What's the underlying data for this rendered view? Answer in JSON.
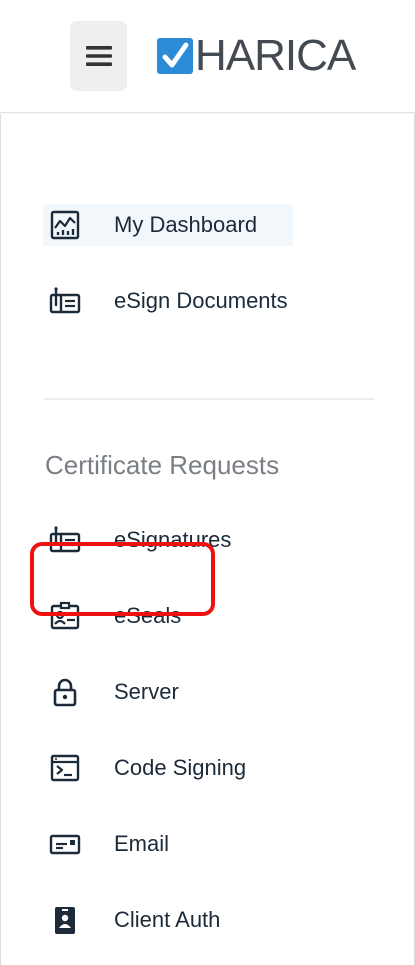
{
  "header": {
    "logo_text": "HARICA",
    "menu_icon": "hamburger-menu-icon",
    "brand_color": "#2b8bd6"
  },
  "sidebar": {
    "main_items": [
      {
        "label": "My Dashboard",
        "icon": "dashboard-chart-icon",
        "active": true
      },
      {
        "label": "eSign Documents",
        "icon": "esign-document-icon",
        "active": false
      }
    ],
    "section_title": "Certificate Requests",
    "request_items": [
      {
        "label": "eSignatures",
        "icon": "esignature-icon"
      },
      {
        "label": "eSeals",
        "icon": "eseal-badge-icon"
      },
      {
        "label": "Server",
        "icon": "lock-icon",
        "highlighted": true
      },
      {
        "label": "Code Signing",
        "icon": "code-terminal-icon"
      },
      {
        "label": "Email",
        "icon": "email-card-icon"
      },
      {
        "label": "Client Auth",
        "icon": "id-badge-icon"
      }
    ],
    "highlight_color": "#ee1111"
  }
}
